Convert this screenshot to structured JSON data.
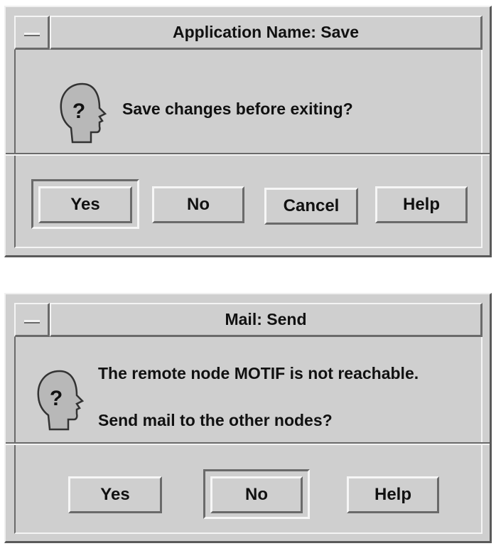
{
  "dialogs": [
    {
      "title": "Application Name: Save",
      "message": "Save changes before exiting?",
      "icon": "question-head-icon",
      "buttons": [
        "Yes",
        "No",
        "Cancel",
        "Help"
      ],
      "default_button": "Yes"
    },
    {
      "title": "Mail: Send",
      "message_line1": "The remote node MOTIF is not reachable.",
      "message_line2": "Send mail to the other nodes?",
      "icon": "question-head-icon",
      "buttons": [
        "Yes",
        "No",
        "Help"
      ],
      "default_button": "No"
    }
  ],
  "colors": {
    "dialog_bg": "#cfcfcf",
    "highlight": "#f4f4f4",
    "shadow": "#6a6a6a"
  }
}
